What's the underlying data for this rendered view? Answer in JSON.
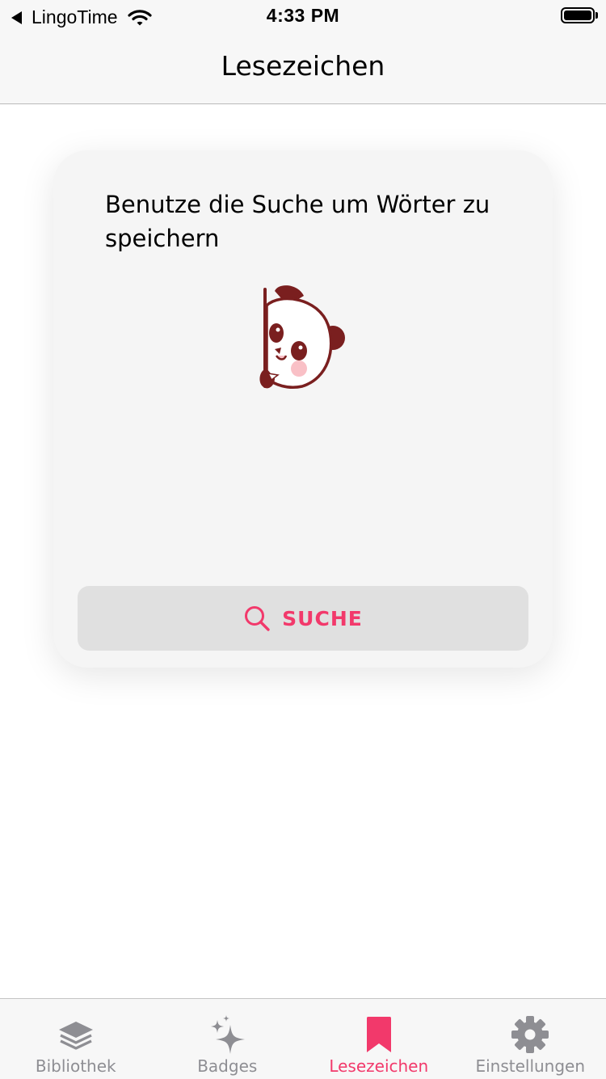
{
  "status_bar": {
    "back_app": "LingoTime",
    "time": "4:33 PM"
  },
  "nav": {
    "title": "Lesezeichen"
  },
  "card": {
    "message": "Benutze die Suche um Wörter zu speichern",
    "illustration": "panda-peeking",
    "search_button_label": "SUCHE",
    "search_icon": "search-icon"
  },
  "tab_bar": {
    "tabs": [
      {
        "label": "Bibliothek",
        "icon": "layers-icon",
        "active": false
      },
      {
        "label": "Badges",
        "icon": "sparkles-icon",
        "active": false
      },
      {
        "label": "Lesezeichen",
        "icon": "bookmark-icon",
        "active": true
      },
      {
        "label": "Einstellungen",
        "icon": "gear-icon",
        "active": false
      }
    ]
  },
  "colors": {
    "accent": "#f2396b",
    "inactive": "#8e8e93",
    "bar_background": "#f7f7f7",
    "card_background": "#f5f5f5",
    "button_background": "#e0e0e0",
    "panda_dark": "#7a1f1f",
    "panda_blush": "#f9c0c6"
  }
}
